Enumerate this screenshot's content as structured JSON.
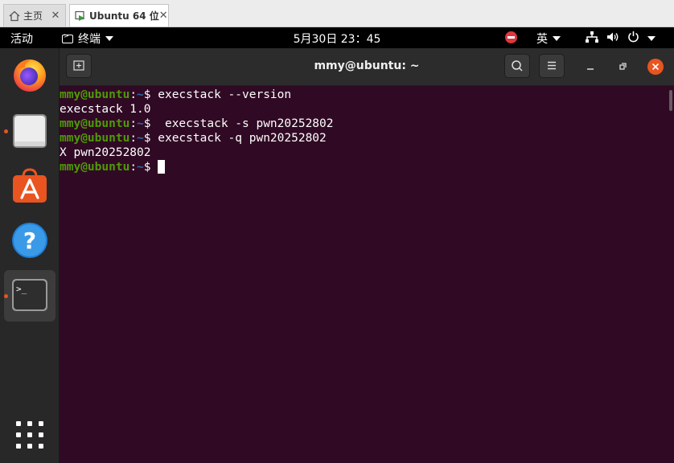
{
  "vm_tabs": {
    "home_label": "主页",
    "active_label": "Ubuntu 64 位",
    "close_symbol": "✕"
  },
  "topbar": {
    "activities": "活动",
    "app_name": "终端",
    "clock": "5月30日  23：45",
    "input_method": "英"
  },
  "dock": {
    "items": [
      "firefox-icon",
      "files-icon",
      "ubuntu-software-icon",
      "help-icon",
      "terminal-icon",
      "show-apps-icon"
    ],
    "help_glyph": "?",
    "terminal_glyph": ">_",
    "accent_color": "#e95420"
  },
  "terminal": {
    "title": "mmy@ubuntu: ~",
    "background": "#300a24",
    "prompt_user": "mmy@ubuntu",
    "prompt_sep": ":",
    "prompt_path": "~",
    "prompt_dollar": "$",
    "lines": [
      {
        "type": "cmd",
        "text": " execstack --version"
      },
      {
        "type": "out",
        "text": "execstack 1.0"
      },
      {
        "type": "cmd",
        "text": "  execstack -s pwn20252802"
      },
      {
        "type": "cmd",
        "text": " execstack -q pwn20252802"
      },
      {
        "type": "out",
        "text": "X pwn20252802"
      },
      {
        "type": "cmd",
        "text": " "
      }
    ]
  }
}
